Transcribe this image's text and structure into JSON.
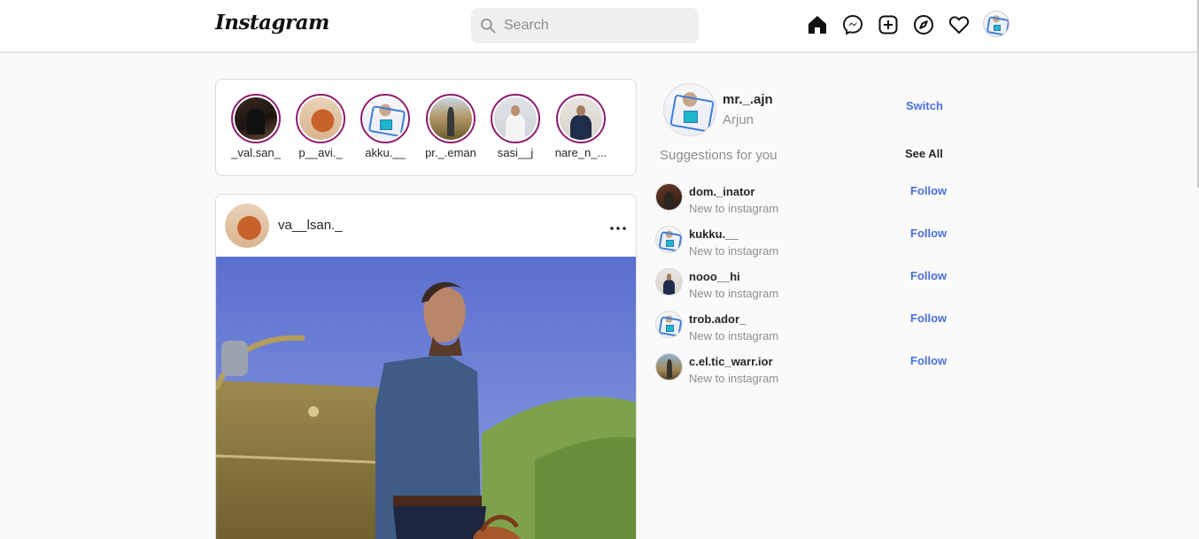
{
  "header": {
    "logo": "Instagram",
    "search_placeholder": "Search",
    "nav_icons": [
      "home-icon",
      "messenger-icon",
      "new-post-icon",
      "explore-icon",
      "activity-heart-icon",
      "profile-avatar"
    ]
  },
  "stories": [
    {
      "username": "_val.san_",
      "avatar": "dark"
    },
    {
      "username": "p__avi._",
      "avatar": "orange"
    },
    {
      "username": "akku.__",
      "avatar": "hoodie"
    },
    {
      "username": "pr._.eman",
      "avatar": "field"
    },
    {
      "username": "sasi__j",
      "avatar": "white"
    },
    {
      "username": "nare_n_...",
      "avatar": "navy"
    }
  ],
  "post": {
    "username": "va__lsan._",
    "more_icon": "more-horizontal-icon"
  },
  "sidebar": {
    "username": "mr._.ajn",
    "full_name": "Arjun",
    "switch_label": "Switch",
    "suggestions_title": "Suggestions for you",
    "see_all_label": "See All",
    "suggestions": [
      {
        "username": "dom._inator",
        "subtitle": "New to instagram",
        "follow": "Follow"
      },
      {
        "username": "kukku.__",
        "subtitle": "New to instagram",
        "follow": "Follow"
      },
      {
        "username": "nooo__hi",
        "subtitle": "New to instagram",
        "follow": "Follow"
      },
      {
        "username": "trob.ador_",
        "subtitle": "New to instagram",
        "follow": "Follow"
      },
      {
        "username": "c.el.tic_warr.ior",
        "subtitle": "New to instagram",
        "follow": "Follow"
      }
    ]
  },
  "colors": {
    "background": "#fafafa",
    "story_ring": "#8e1c6e",
    "link_blue": "#4a6fdc",
    "muted_text": "#8e8e8e"
  }
}
